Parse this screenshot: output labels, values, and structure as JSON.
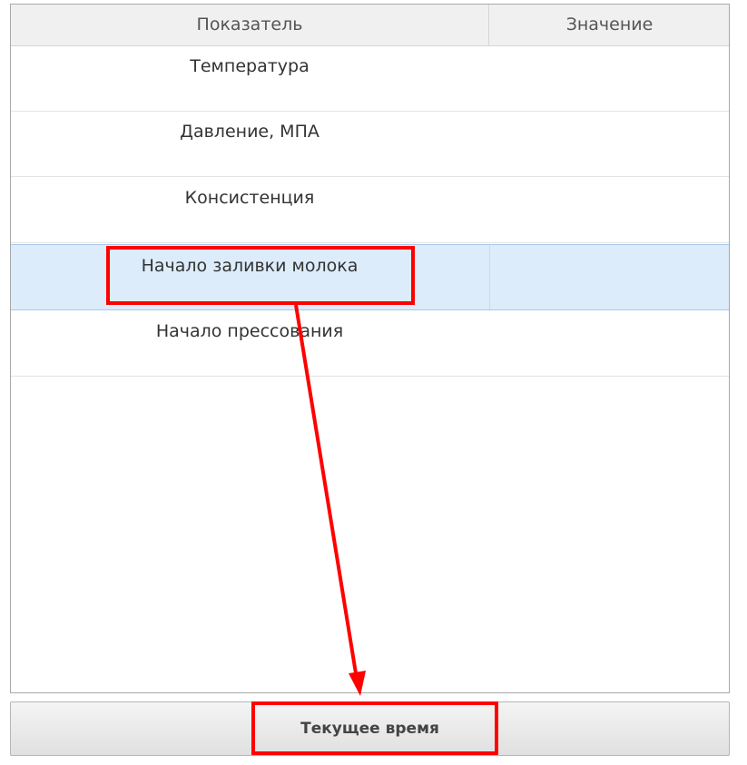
{
  "table": {
    "headers": [
      "Показатель",
      "Значение"
    ],
    "rows": [
      {
        "name": "Температура",
        "value": ""
      },
      {
        "name": "Давление, МПА",
        "value": ""
      },
      {
        "name": "Консистенция",
        "value": ""
      },
      {
        "name": "Начало заливки молока",
        "value": "",
        "selected": true
      },
      {
        "name": "Начало прессования",
        "value": ""
      }
    ]
  },
  "button": {
    "label": "Текущее время"
  },
  "annotation": {
    "color": "#ff0000"
  },
  "colors": {
    "selection": "#dcecfb",
    "header": "#f0f0f0"
  }
}
